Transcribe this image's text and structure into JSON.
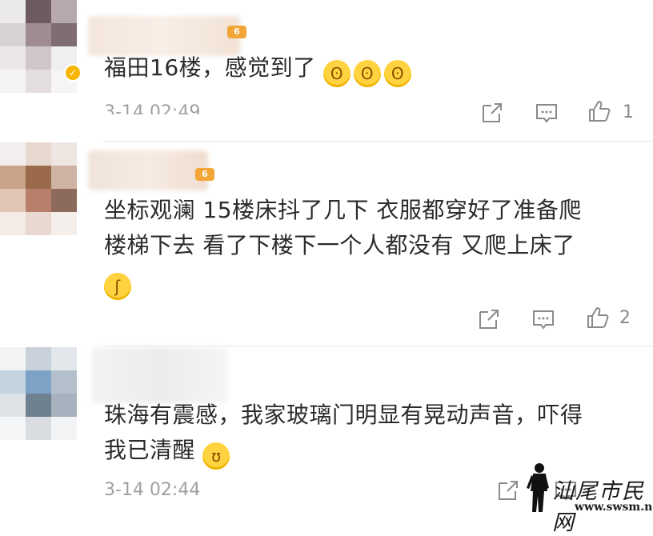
{
  "comments": [
    {
      "text": "福田16楼，感觉到了",
      "emojis": [
        "ok-hand-face-emoji",
        "ok-hand-face-emoji",
        "ok-hand-face-emoji"
      ],
      "time": "3-14 02:49",
      "likes": "1",
      "level_badge": "6"
    },
    {
      "text_line1": "坐标观澜 15楼床抖了几下 衣服都穿好了准备爬",
      "text_line2": "楼梯下去 看了下楼下一个人都没有 又爬上床了",
      "emojis": [
        "shush-face-emoji"
      ],
      "likes": "2",
      "level_badge": "6"
    },
    {
      "text_line1": "珠海有震感，我家玻璃门明显有晃动声音，吓得",
      "text_line2": "我已清醒",
      "emojis": [
        "laugh-cry-emoji"
      ],
      "time": "3-14 02:44"
    }
  ],
  "watermark": {
    "title": "汕尾市民网",
    "url": "www.swsm.net"
  },
  "colors": {
    "text": "#2b2b2b",
    "meta": "#a0a0a0",
    "icon": "#8a8a8a",
    "emoji": "#ffd23f",
    "badge": "#f7b500"
  }
}
